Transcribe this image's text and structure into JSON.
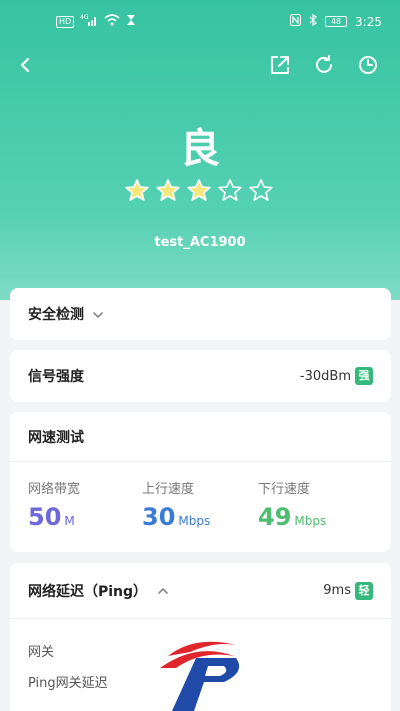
{
  "status_bar": {
    "time": "3:25",
    "left_icons": [
      "hd-chip-icon",
      "signal-icon",
      "wifi-icon",
      "hourglass-icon"
    ],
    "right_icons": [
      "nfc-icon",
      "bluetooth-icon",
      "battery-icon"
    ],
    "battery": "48",
    "hd_label": "HD",
    "net_label": "4G"
  },
  "header": {
    "back_icon": "back-arrow-icon",
    "actions": [
      "share-icon",
      "refresh-icon",
      "history-clock-icon"
    ]
  },
  "rating": {
    "grade": "良",
    "stars_filled": 3,
    "stars_total": 5,
    "star_filled_color": "#f6e77a",
    "star_empty_color": "#ffffff",
    "ssid": "test_AC1900"
  },
  "security": {
    "title": "安全检测"
  },
  "signal": {
    "title": "信号强度",
    "value": "-30dBm",
    "badge": "强",
    "badge_color": "#35b97b"
  },
  "speed_test": {
    "title": "网速测试",
    "metrics": [
      {
        "label": "网络带宽",
        "value": "50",
        "unit": "M",
        "color": "#6d68d8"
      },
      {
        "label": "上行速度",
        "value": "30",
        "unit": "Mbps",
        "color": "#3a7bd5"
      },
      {
        "label": "下行速度",
        "value": "49",
        "unit": "Mbps",
        "color": "#4fbd6f"
      }
    ]
  },
  "latency": {
    "title": "网络延迟（Ping）",
    "value": "9ms",
    "badge": "轻",
    "items": [
      "网关",
      "Ping网关延迟"
    ]
  },
  "colors": {
    "accent": "#39c6a4",
    "page_bg": "#f2f4f6"
  }
}
